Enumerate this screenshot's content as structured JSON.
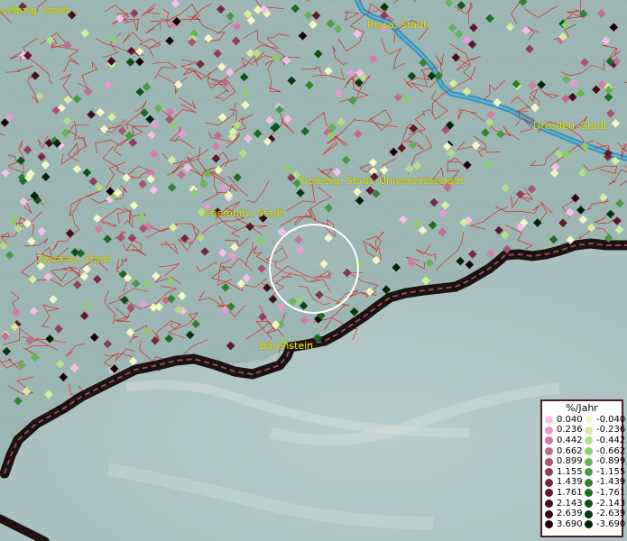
{
  "map": {
    "cities": [
      {
        "id": "leipzig",
        "name": "Leipzig, Stadt"
      },
      {
        "id": "riesa",
        "name": "Riesa, Stadt"
      },
      {
        "id": "dresden",
        "name": "Dresden, Stadt"
      },
      {
        "id": "freiberg",
        "name": "Freiberg, Stadt, Universitätsstadt"
      },
      {
        "id": "chemnitz",
        "name": "Chemnitz, Stadt"
      },
      {
        "id": "zwickau",
        "name": "Zwickau, Stadt"
      },
      {
        "id": "baerenstein",
        "name": "Bärenstein"
      }
    ]
  },
  "legend": {
    "title": "%/Jahr",
    "positive": [
      {
        "value": "0.040",
        "color": "#f7bfe9"
      },
      {
        "value": "0.236",
        "color": "#e89ad3"
      },
      {
        "value": "0.442",
        "color": "#d67aa8"
      },
      {
        "value": "0.662",
        "color": "#c26a8e"
      },
      {
        "value": "0.899",
        "color": "#a8536f"
      },
      {
        "value": "1.155",
        "color": "#8f3e57"
      },
      {
        "value": "1.439",
        "color": "#762a40"
      },
      {
        "value": "1.761",
        "color": "#5e1a2c"
      },
      {
        "value": "2.143",
        "color": "#470e1c"
      },
      {
        "value": "2.639",
        "color": "#300610"
      },
      {
        "value": "3.690",
        "color": "#1a0006"
      }
    ],
    "negative": [
      {
        "value": "-0.040",
        "color": "#f3f7c4"
      },
      {
        "value": "-0.236",
        "color": "#d7ee9e"
      },
      {
        "value": "-0.442",
        "color": "#b4df86"
      },
      {
        "value": "-0.662",
        "color": "#8ccc6c"
      },
      {
        "value": "-0.899",
        "color": "#66b254"
      },
      {
        "value": "-1.155",
        "color": "#489a42"
      },
      {
        "value": "-1.439",
        "color": "#318333"
      },
      {
        "value": "-1.761",
        "color": "#1f6b26"
      },
      {
        "value": "-2.143",
        "color": "#10511a"
      },
      {
        "value": "-2.639",
        "color": "#06380f"
      },
      {
        "value": "-3.690",
        "color": "#002206"
      }
    ]
  },
  "colors": {
    "boundary": "#d12a2a",
    "river": "#3b92b8",
    "border_outer": "#1c1212",
    "border_inner": "#8b4a5a",
    "label": "#e6e600",
    "selection_ring": "#ffffff"
  },
  "icons": [
    "selection-circle-icon",
    "measurement-point-marker-icon"
  ]
}
